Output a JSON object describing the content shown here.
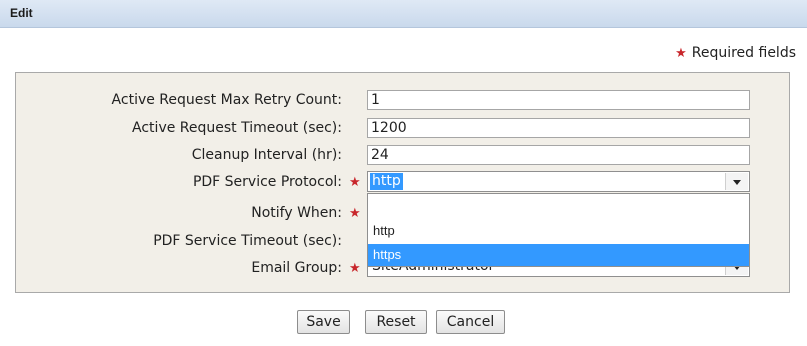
{
  "dialog": {
    "title": "Edit",
    "required_note": "Required fields"
  },
  "form": {
    "active_request_max_retry_count": {
      "label": "Active Request Max Retry Count:",
      "value": "1"
    },
    "active_request_timeout": {
      "label": "Active Request Timeout (sec):",
      "value": "1200"
    },
    "cleanup_interval": {
      "label": "Cleanup Interval (hr):",
      "value": "24"
    },
    "pdf_service_protocol": {
      "label": "PDF Service Protocol:",
      "value": "http",
      "options": [
        "",
        "http",
        "https"
      ],
      "highlighted_option": "https"
    },
    "notify_when": {
      "label": "Notify When:"
    },
    "pdf_service_timeout": {
      "label": "PDF Service Timeout (sec):"
    },
    "email_group": {
      "label": "Email Group:",
      "value": "SiteAdministrator"
    }
  },
  "buttons": {
    "save": "Save",
    "reset": "Reset",
    "cancel": "Cancel"
  },
  "colors": {
    "required_star": "#c8262b",
    "selection_highlight": "#3399ff",
    "panel_background": "#f2efe8"
  }
}
